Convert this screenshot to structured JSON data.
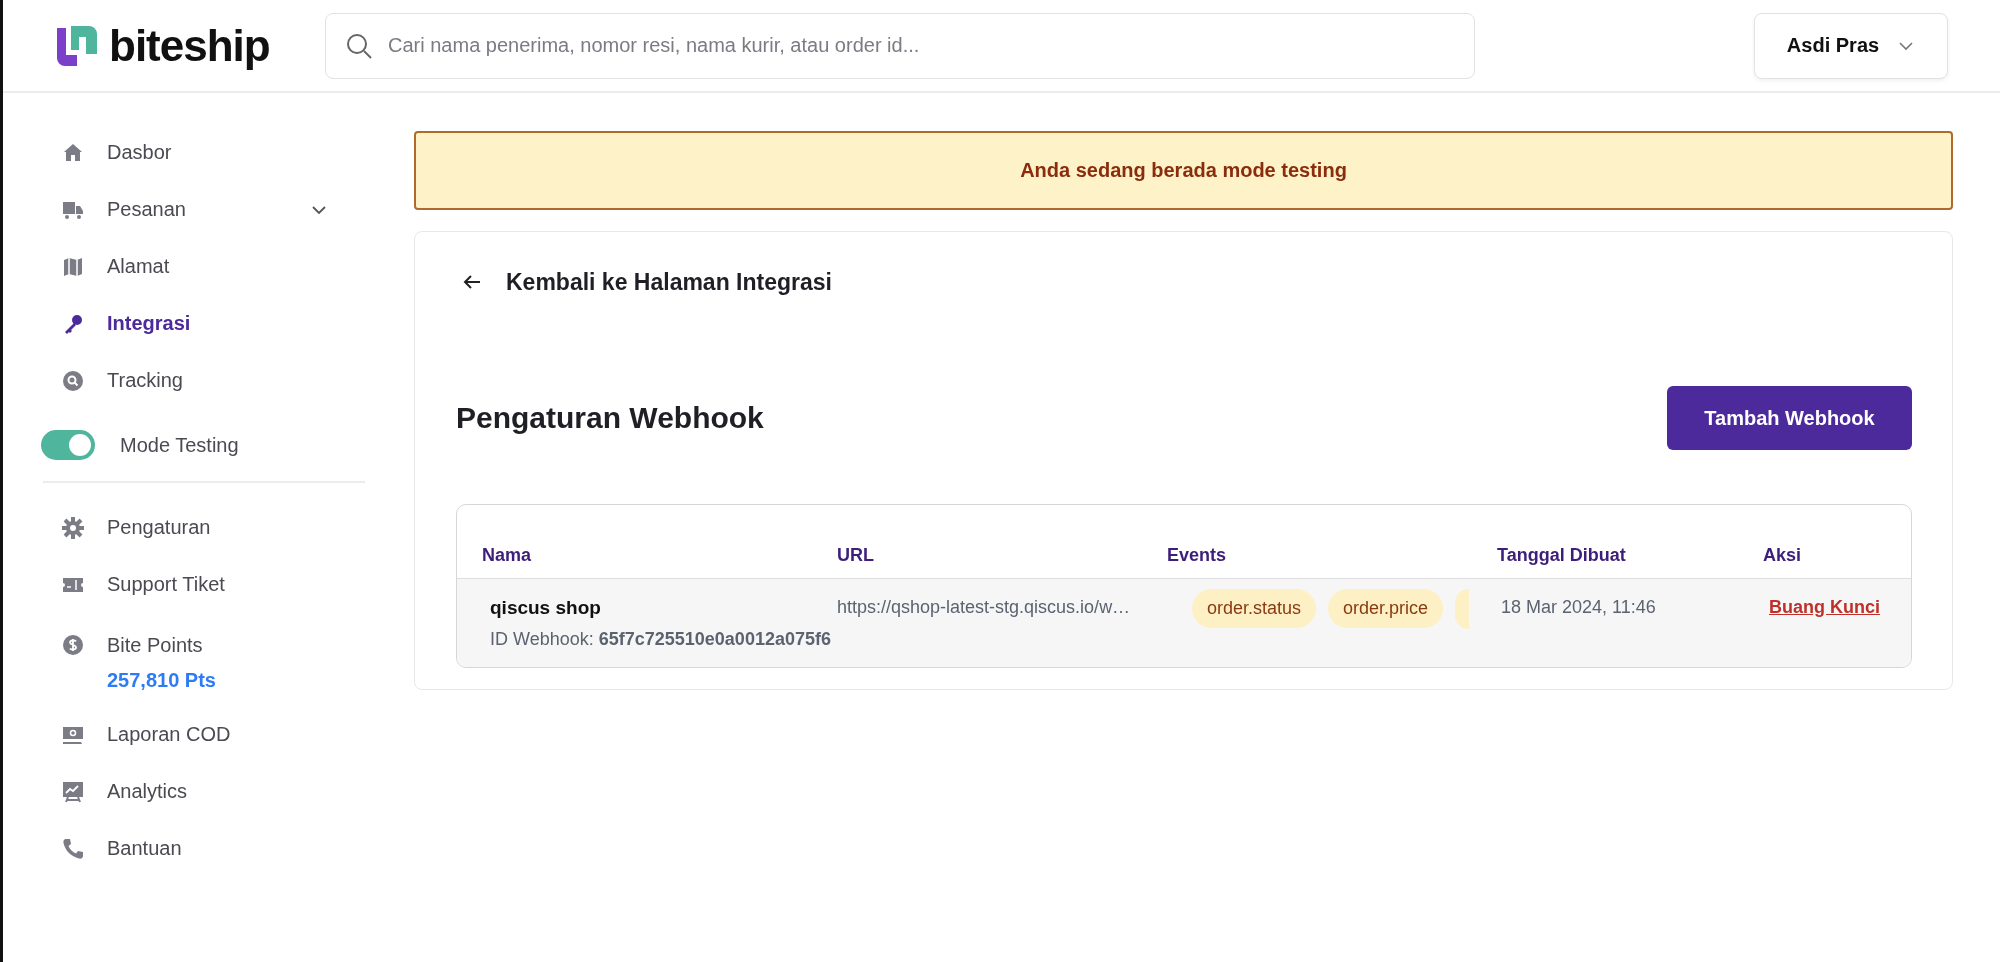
{
  "header": {
    "logo_text": "biteship",
    "search": {
      "placeholder": "Cari nama penerima, nomor resi, nama kurir, atau order id..."
    },
    "user_name": "Asdi Pras"
  },
  "sidebar": {
    "items": [
      {
        "label": "Dasbor",
        "selected": false
      },
      {
        "label": "Pesanan",
        "selected": false,
        "expanded": false
      },
      {
        "label": "Alamat",
        "selected": false
      },
      {
        "label": "Integrasi",
        "selected": true
      },
      {
        "label": "Tracking",
        "selected": false
      }
    ],
    "mode_toggle": {
      "label": "Mode Testing",
      "on": true
    },
    "items_2": [
      {
        "label": "Pengaturan",
        "selected": false
      },
      {
        "label": "Support Tiket",
        "selected": false
      },
      {
        "label": "Bite Points",
        "selected": false,
        "points": "257,810 Pts"
      },
      {
        "label": "Laporan COD",
        "selected": false
      },
      {
        "label": "Analytics",
        "selected": false
      },
      {
        "label": "Bantuan",
        "selected": false
      }
    ]
  },
  "banner": {
    "text": "Anda sedang berada mode testing"
  },
  "back_link": "Kembali ke Halaman Integrasi",
  "title": "Pengaturan Webhook",
  "add_button": "Tambah Webhook",
  "table": {
    "columns": [
      "Nama",
      "URL",
      "Events",
      "Tanggal Dibuat",
      "Aksi"
    ],
    "rows": [
      {
        "name": "qiscus shop",
        "webhook_id": "ID Webhook: **65f7c725510e0a0012a075f6**",
        "url": "https://qshop-latest-stg.qiscus.io/w…",
        "events": [
          "order.status",
          "order.price"
        ],
        "created": "18 Mar 2024, 11:46",
        "action": "Buang Kunci"
      }
    ]
  }
}
